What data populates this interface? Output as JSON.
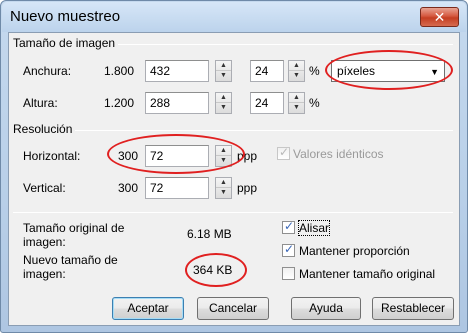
{
  "window": {
    "title": "Nuevo muestreo",
    "close_label": "✕"
  },
  "image_size": {
    "group_title": "Tamaño de imagen",
    "width": {
      "label": "Anchura:",
      "original": "1.800",
      "value": "432",
      "percent": "24",
      "percent_unit": "%"
    },
    "height": {
      "label": "Altura:",
      "original": "1.200",
      "value": "288",
      "percent": "24",
      "percent_unit": "%"
    },
    "unit_select": {
      "selected": "píxeles",
      "arrow": "▼"
    }
  },
  "resolution": {
    "group_title": "Resolución",
    "horizontal": {
      "label": "Horizontal:",
      "original": "300",
      "value": "72",
      "unit": "ppp"
    },
    "vertical": {
      "label": "Vertical:",
      "original": "300",
      "value": "72",
      "unit": "ppp"
    },
    "same_values": {
      "label": "Valores idénticos",
      "checked": true,
      "enabled": false
    }
  },
  "info": {
    "original_label": "Tamaño original de imagen:",
    "original_value": "6.18 MB",
    "new_label": "Nuevo tamaño de imagen:",
    "new_value": "364 KB"
  },
  "options": {
    "smooth": {
      "label": "Alisar",
      "checked": true
    },
    "keep_ratio": {
      "label": "Mantener proporción",
      "checked": true
    },
    "keep_original": {
      "label": "Mantener tamaño original",
      "checked": false
    }
  },
  "buttons": {
    "ok": "Aceptar",
    "cancel": "Cancelar",
    "help": "Ayuda",
    "reset": "Restablecer"
  },
  "spin": {
    "up": "▲",
    "down": "▼"
  },
  "check_mark": "✓",
  "annotation_color": "#e02020"
}
